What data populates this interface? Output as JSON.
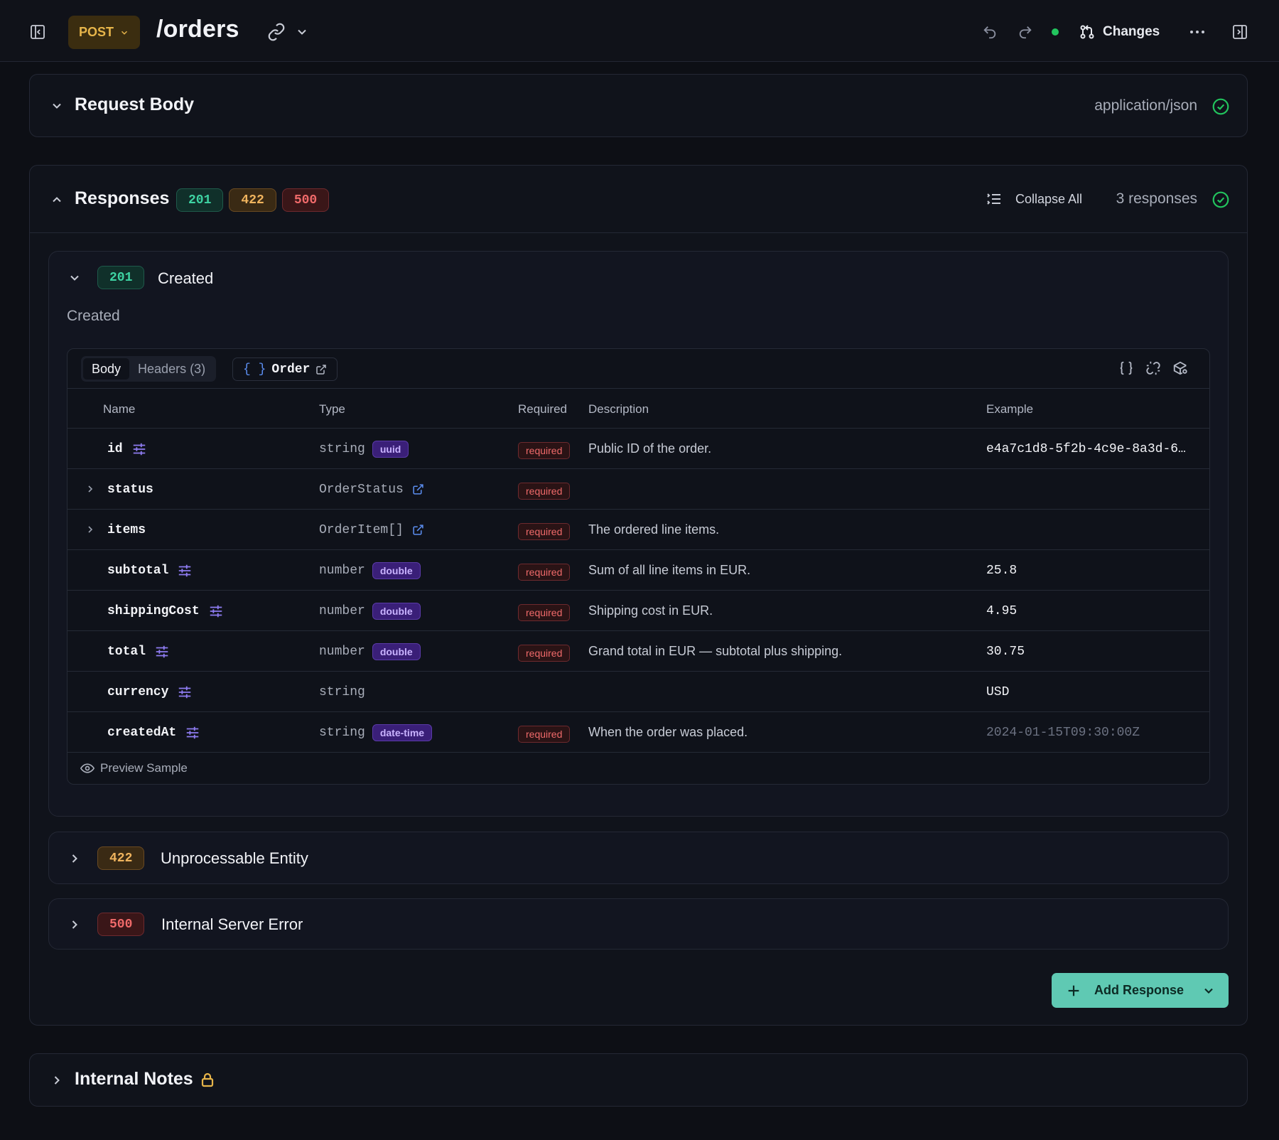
{
  "header": {
    "method": "POST",
    "path": "/orders",
    "changes_label": "Changes"
  },
  "request_body": {
    "title": "Request Body",
    "content_type": "application/json"
  },
  "responses": {
    "title": "Responses",
    "codes": [
      "201",
      "422",
      "500"
    ],
    "collapse_all_label": "Collapse All",
    "count_label": "3 responses",
    "items": [
      {
        "code": "201",
        "title": "Created",
        "description": "Created",
        "tabs": {
          "body": "Body",
          "headers": "Headers (3)",
          "schema_ref": "Order"
        },
        "columns": {
          "name": "Name",
          "type": "Type",
          "required": "Required",
          "description": "Description",
          "example": "Example"
        },
        "fields": [
          {
            "name": "id",
            "type": "string",
            "format": "uuid",
            "required": "required",
            "description": "Public ID of the order.",
            "example": "e4a7c1d8-5f2b-4c9e-8a3d-6…"
          },
          {
            "name": "status",
            "type": "OrderStatus",
            "format": "",
            "required": "required",
            "description": "",
            "example": ""
          },
          {
            "name": "items",
            "type": "OrderItem[]",
            "format": "",
            "required": "required",
            "description": "The ordered line items.",
            "example": ""
          },
          {
            "name": "subtotal",
            "type": "number",
            "format": "double",
            "required": "required",
            "description": "Sum of all line items in EUR.",
            "example": "25.8"
          },
          {
            "name": "shippingCost",
            "type": "number",
            "format": "double",
            "required": "required",
            "description": "Shipping cost in EUR.",
            "example": "4.95"
          },
          {
            "name": "total",
            "type": "number",
            "format": "double",
            "required": "required",
            "description": "Grand total in EUR — subtotal plus shipping.",
            "example": "30.75"
          },
          {
            "name": "currency",
            "type": "string",
            "format": "",
            "required": "",
            "description": "",
            "example": "USD"
          },
          {
            "name": "createdAt",
            "type": "string",
            "format": "date-time",
            "required": "required",
            "description": "When the order was placed.",
            "example": "2024-01-15T09:30:00Z"
          }
        ],
        "preview_label": "Preview Sample"
      },
      {
        "code": "422",
        "title": "Unprocessable Entity"
      },
      {
        "code": "500",
        "title": "Internal Server Error"
      }
    ],
    "add_button_label": "Add Response"
  },
  "internal_notes": {
    "title": "Internal Notes"
  },
  "colors": {
    "accent_green": "#22c55e",
    "teal_button": "#5fc9b3",
    "method_post": "#e7b54a",
    "format_purple": "#3a1f78",
    "required_red": "#f06a6a"
  }
}
